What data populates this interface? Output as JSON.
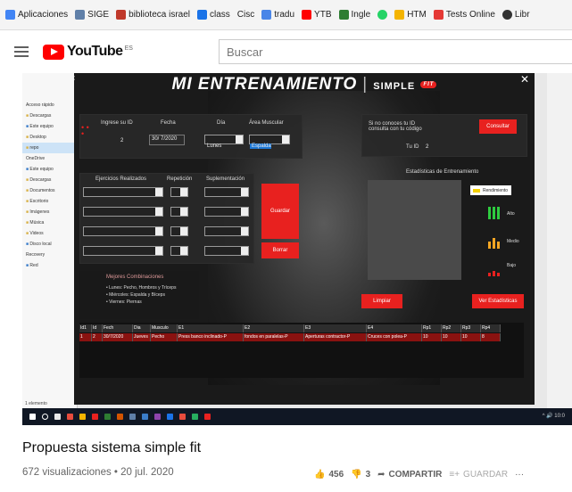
{
  "bookmarks": [
    {
      "label": "Aplicaciones",
      "color": "#4285f4"
    },
    {
      "label": "SIGE",
      "color": "#5f7fa8"
    },
    {
      "label": "biblioteca israel",
      "color": "#c0392b"
    },
    {
      "label": "class",
      "color": "#1a73e8"
    },
    {
      "label": "Cisc",
      "color": "#777777"
    },
    {
      "label": "tradu",
      "color": "#4a86e8"
    },
    {
      "label": "YTB",
      "color": "#ff0000"
    },
    {
      "label": "Ingle",
      "color": "#2e7d32"
    },
    {
      "label": "",
      "color": "#25d366"
    },
    {
      "label": "HTM",
      "color": "#f4b400"
    },
    {
      "label": "Tests Online",
      "color": "#e53935"
    },
    {
      "label": "Libr",
      "color": "#333333"
    }
  ],
  "youtube": {
    "logo_text": "YouTube",
    "country": "ES",
    "search_placeholder": "Buscar"
  },
  "explorer": {
    "items": [
      "Acceso rápido",
      "Descargas",
      "Este equipo",
      "Desktop",
      "repo",
      "OneDrive",
      "Este equipo",
      "Descargas",
      "Documentos",
      "Escritorio",
      "Imágenes",
      "Música",
      "Videos",
      "Disco local",
      "Recovery",
      "Red"
    ],
    "status": "1 elemento"
  },
  "app": {
    "title": "MI ENTRENAMIENTO",
    "subtitle": "SIMPLE",
    "badge": "FIT",
    "form": {
      "id_label": "Ingrese su ID",
      "id_value": "2",
      "fecha_label": "Fecha",
      "fecha_value": "30/ 7/2020",
      "dia_label": "Día",
      "dia_value": "Lunes",
      "area_label": "Área Muscular",
      "area_value": "Espalda",
      "ej_label": "Ejercicios Realizados",
      "rep_label": "Repetición",
      "sup_label": "Suplementación"
    },
    "id_hint": "Si no conoces tu ID consulta con tu código",
    "tu_id_label": "Tu ID",
    "tu_id_value": "2",
    "buttons": {
      "consultar": "Consultar",
      "guardar": "Guardar",
      "borrar": "Borrar",
      "limpiar": "Limpiar",
      "ver_estadisticas": "Ver Estadísticas"
    },
    "stats_title": "Estadísticas de Entrenamiento",
    "legend": "Rendimiento",
    "levels": [
      {
        "label": "Alto",
        "color": "#2ecc40"
      },
      {
        "label": "Medio",
        "color": "#f5a623"
      },
      {
        "label": "Bajo",
        "color": "#e8211f"
      }
    ],
    "combos": {
      "title": "Mejores Combinaciones",
      "lines": [
        "• Lunes: Pecho, Hombros y Tríceps",
        "• Miércoles: Espalda y Bíceps",
        "• Viernes: Piernas"
      ]
    },
    "table": {
      "headers": [
        "Id1",
        "Id",
        "Fech",
        "Dia",
        "Musculo",
        "E1",
        "E2",
        "E3",
        "E4",
        "Rp1",
        "Rp2",
        "Rp3",
        "Rp4"
      ],
      "rows": [
        [
          "1",
          "2",
          "30/7/2020",
          "Jueves",
          "Pecho",
          "Press banco inclinado-P",
          "fondos en paralelas-P",
          "Aperturas contractor-P",
          "Cruces con polea-P",
          "10",
          "10",
          "10",
          "8"
        ]
      ]
    }
  },
  "tray": "^ 🔊 10:0",
  "video": {
    "title": "Propuesta sistema simple fit",
    "meta": "672 visualizaciones • 20 jul. 2020",
    "likes": "456",
    "dislikes": "3",
    "share": "COMPARTIR",
    "save": "GUARDAR"
  }
}
